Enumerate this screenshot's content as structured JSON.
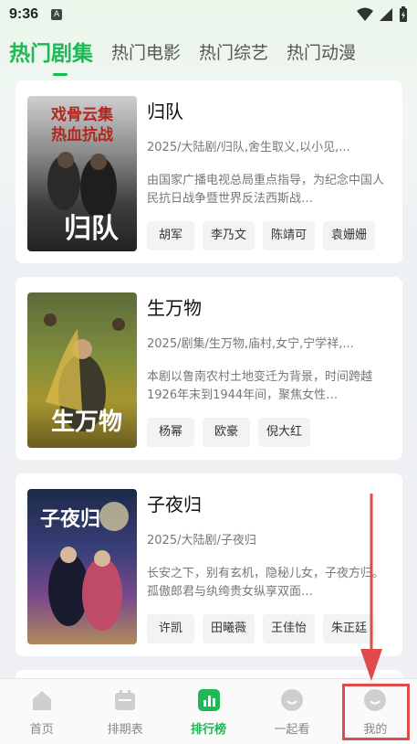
{
  "status": {
    "time": "9:36",
    "notif": "A"
  },
  "tabs": [
    "热门剧集",
    "热门电影",
    "热门综艺",
    "热门动漫"
  ],
  "shows": [
    {
      "title": "归队",
      "meta": "2025/大陆剧/归队,舍生取义,以小见,...",
      "desc": "由国家广播电视总局重点指导，为纪念中国人民抗日战争暨世界反法西斯战…",
      "tags": [
        "胡军",
        "李乃文",
        "陈靖可",
        "袁姗姗"
      ],
      "poster_text": [
        "戏骨云集",
        "热血抗战",
        "归队"
      ]
    },
    {
      "title": "生万物",
      "meta": "2025/剧集/生万物,庙村,女宁,宁学祥,...",
      "desc": "本剧以鲁南农村土地变迁为背景，时间跨越1926年末到1944年间，聚焦女性…",
      "tags": [
        "杨幂",
        "欧豪",
        "倪大红"
      ],
      "poster_text": [
        "生万物"
      ]
    },
    {
      "title": "子夜归",
      "meta": "2025/大陆剧/子夜归",
      "desc": "长安之下，别有玄机，隐秘儿女，子夜方归。孤傲郎君与纨绔贵女纵享双面…",
      "tags": [
        "许凯",
        "田曦薇",
        "王佳怡",
        "朱正廷"
      ],
      "poster_text": [
        "子夜归"
      ]
    }
  ],
  "nav": [
    "首页",
    "排期表",
    "排行榜",
    "一起看",
    "我的"
  ],
  "colors": {
    "accent": "#1db954",
    "highlight": "#e04a4a"
  }
}
